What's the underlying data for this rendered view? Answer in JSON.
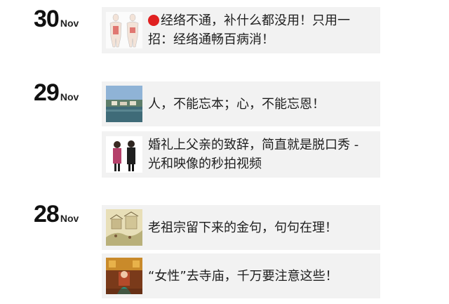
{
  "days": [
    {
      "day": "30",
      "month": "Nov",
      "articles": [
        {
          "title_prefix_icon": "red-circle-icon",
          "title": "经络不通，补什么都没用！只用一招：经络通畅百病消！",
          "thumb": "meridian-body-diagram"
        }
      ]
    },
    {
      "day": "29",
      "month": "Nov",
      "articles": [
        {
          "title": "人，不能忘本；心，不能忘恩！",
          "thumb": "landscape-village-photo"
        },
        {
          "title": "婚礼上父亲的致辞，简直就是脱口秀 - 光和映像的秒拍视频",
          "thumb": "two-people-speech-photo"
        }
      ]
    },
    {
      "day": "28",
      "month": "Nov",
      "articles": [
        {
          "title": "老祖宗留下来的金句，句句在理！",
          "thumb": "ancient-painting-scene"
        },
        {
          "title": "“女性”去寺庙，千万要注意这些！",
          "thumb": "temple-woman-photo"
        }
      ]
    }
  ]
}
